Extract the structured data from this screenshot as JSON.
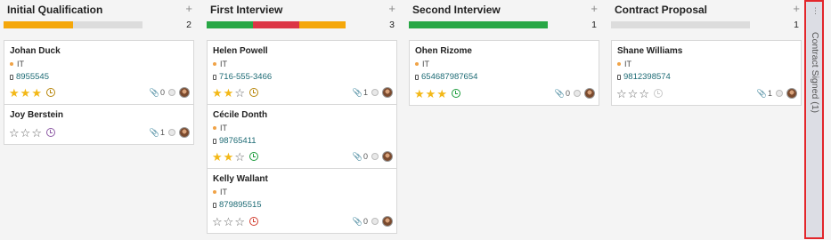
{
  "columns": [
    {
      "title": "Initial Qualification",
      "count": "2",
      "progress": [
        {
          "fraction": 0.5,
          "color": "#f5a70a"
        }
      ],
      "cards": [
        {
          "name": "Johan Duck",
          "tag": "IT",
          "phone": "8955545",
          "stars": 3,
          "activity": "warn",
          "attachments": "0",
          "short": false
        },
        {
          "name": "Joy Berstein",
          "tag": "",
          "phone": "",
          "stars": 0,
          "activity": "planned",
          "attachments": "1",
          "short": true
        }
      ]
    },
    {
      "title": "First Interview",
      "count": "3",
      "progress": [
        {
          "fraction": 0.333,
          "color": "#28a745"
        },
        {
          "fraction": 0.333,
          "color": "#dc3545"
        },
        {
          "fraction": 0.334,
          "color": "#f5a70a"
        }
      ],
      "cards": [
        {
          "name": "Helen Powell",
          "tag": "IT",
          "phone": "716-555-3466",
          "stars": 2,
          "activity": "warn",
          "attachments": "1",
          "short": false
        },
        {
          "name": "Cécile Donth",
          "tag": "IT",
          "phone": "98765411",
          "stars": 2,
          "activity": "ok",
          "attachments": "0",
          "short": false
        },
        {
          "name": "Kelly Wallant",
          "tag": "IT",
          "phone": "879895515",
          "stars": 0,
          "activity": "late",
          "attachments": "0",
          "short": false
        }
      ]
    },
    {
      "title": "Second Interview",
      "count": "1",
      "progress": [
        {
          "fraction": 1.0,
          "color": "#28a745"
        }
      ],
      "cards": [
        {
          "name": "Ohen Rizome",
          "tag": "IT",
          "phone": "654687987654",
          "stars": 3,
          "activity": "ok",
          "attachments": "0",
          "short": false
        }
      ]
    },
    {
      "title": "Contract Proposal",
      "count": "1",
      "progress": [],
      "cards": [
        {
          "name": "Shane Williams",
          "tag": "IT",
          "phone": "9812398574",
          "stars": 0,
          "activity": "none",
          "attachments": "1",
          "short": false
        }
      ]
    }
  ],
  "folded_column": {
    "label": "Contract Signed (1)"
  },
  "icons": {
    "add": "+",
    "star": "★",
    "star_empty": "☆",
    "clip": "📎"
  },
  "colors": {
    "link": "#1c6a74",
    "star": "#f3b817",
    "fold_border": "#e3262b"
  }
}
